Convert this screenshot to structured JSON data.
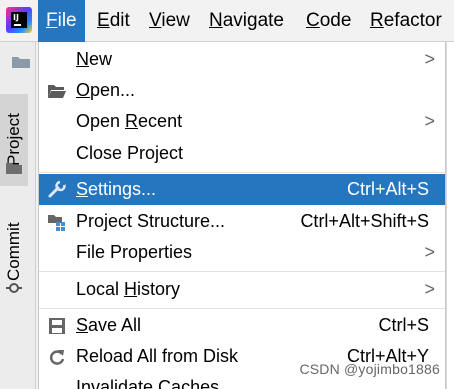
{
  "menubar": {
    "items": [
      {
        "label": "File",
        "mnemonic": "F",
        "rest": "ile"
      },
      {
        "label": "Edit",
        "mnemonic": "E",
        "rest": "dit"
      },
      {
        "label": "View",
        "mnemonic": "V",
        "rest": "iew"
      },
      {
        "label": "Navigate",
        "mnemonic": "N",
        "rest": "avigate"
      },
      {
        "label": "Code",
        "mnemonic": "C",
        "rest": "ode"
      },
      {
        "label": "Refactor",
        "mnemonic": "R",
        "rest": "efactor"
      }
    ]
  },
  "leftstrip": {
    "tabs": [
      {
        "label": "Project"
      },
      {
        "label": "Commit"
      }
    ]
  },
  "file_menu": {
    "new": {
      "label": "New",
      "mnemonic": "N",
      "rest": "ew",
      "submenu": ">"
    },
    "open": {
      "label": "Open...",
      "mnemonic": "O",
      "rest": "pen..."
    },
    "open_recent": {
      "pre": "Open ",
      "mnemonic": "R",
      "rest": "ecent",
      "submenu": ">"
    },
    "close_project": {
      "label": "Close Project"
    },
    "settings": {
      "mnemonic": "S",
      "rest": "ettings...",
      "shortcut": "Ctrl+Alt+S"
    },
    "project_structure": {
      "label": "Project Structure...",
      "shortcut": "Ctrl+Alt+Shift+S"
    },
    "file_properties": {
      "label": "File Properties",
      "submenu": ">"
    },
    "local_history": {
      "pre": "Local ",
      "mnemonic": "H",
      "rest": "istory",
      "submenu": ">"
    },
    "save_all": {
      "mnemonic": "S",
      "rest": "ave All",
      "shortcut": "Ctrl+S"
    },
    "reload_all": {
      "label": "Reload All from Disk",
      "shortcut": "Ctrl+Alt+Y"
    },
    "invalidate_caches": {
      "label": "Invalidate Caches..."
    }
  },
  "watermark": "CSDN @yojimbo1886",
  "colors": {
    "accent": "#2675bf",
    "menu_bg": "#ffffff",
    "chrome_bg": "#f2f2f2"
  }
}
